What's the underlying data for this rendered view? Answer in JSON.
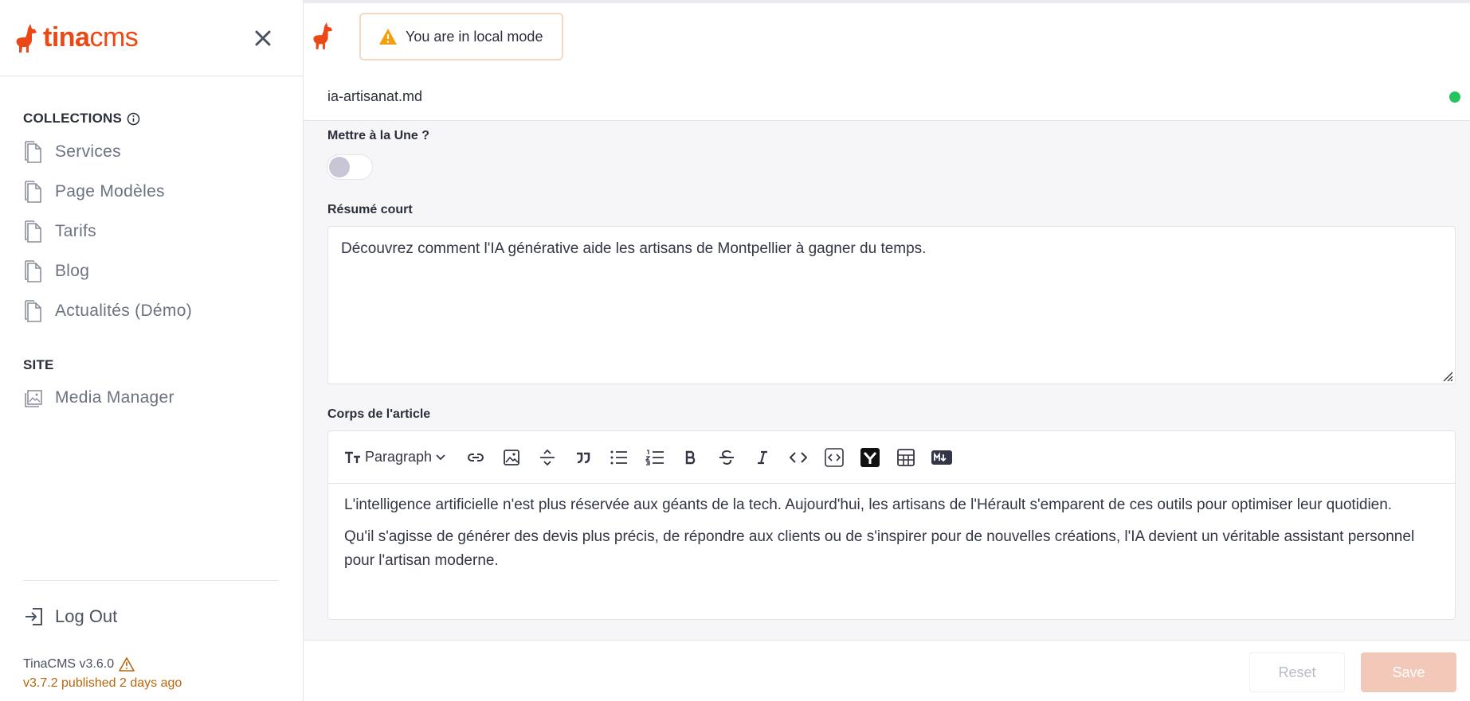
{
  "brand": {
    "logo_bold": "tina",
    "logo_light": "cms"
  },
  "sidebar": {
    "collections_heading": "COLLECTIONS",
    "collections": [
      {
        "label": "Services"
      },
      {
        "label": "Page Modèles"
      },
      {
        "label": "Tarifs"
      },
      {
        "label": "Blog"
      },
      {
        "label": "Actualités (Démo)"
      }
    ],
    "site_heading": "SITE",
    "site_items": [
      {
        "label": "Media Manager"
      }
    ],
    "logout_label": "Log Out",
    "version": "TinaCMS v3.6.0",
    "update_notice": "v3.7.2 published 2 days ago"
  },
  "header": {
    "local_mode_text": "You are in local mode",
    "filename": "ia-artisanat.md",
    "status_color": "#22c55e"
  },
  "form": {
    "featured_label": "Mettre à la Une ?",
    "featured_value": false,
    "summary_label": "Résumé court",
    "summary_value": "Découvrez comment l'IA générative aide les artisans de Montpellier à gagner du temps.",
    "body_label": "Corps de l'article",
    "toolbar": {
      "block_type": "Paragraph",
      "buttons": [
        "link-icon",
        "image-icon",
        "divider-icon",
        "quote-icon",
        "bullet-list-icon",
        "ordered-list-icon",
        "bold-icon",
        "strikethrough-icon",
        "italic-icon",
        "code-icon",
        "code-block-icon",
        "embed-icon",
        "table-icon",
        "markdown-icon"
      ]
    },
    "body_paragraphs": [
      "L'intelligence artificielle n'est plus réservée aux géants de la tech. Aujourd'hui, les artisans de l'Hérault s'emparent de ces outils pour optimiser leur quotidien.",
      "Qu'il s'agisse de générer des devis plus précis, de répondre aux clients ou de s'inspirer pour de nouvelles créations, l'IA devient un véritable assistant personnel pour l'artisan moderne."
    ]
  },
  "footer": {
    "reset_label": "Reset",
    "save_label": "Save"
  },
  "colors": {
    "brand": "#ec4815",
    "warning": "#f59e0b",
    "save_bg": "#f2c9b9"
  }
}
